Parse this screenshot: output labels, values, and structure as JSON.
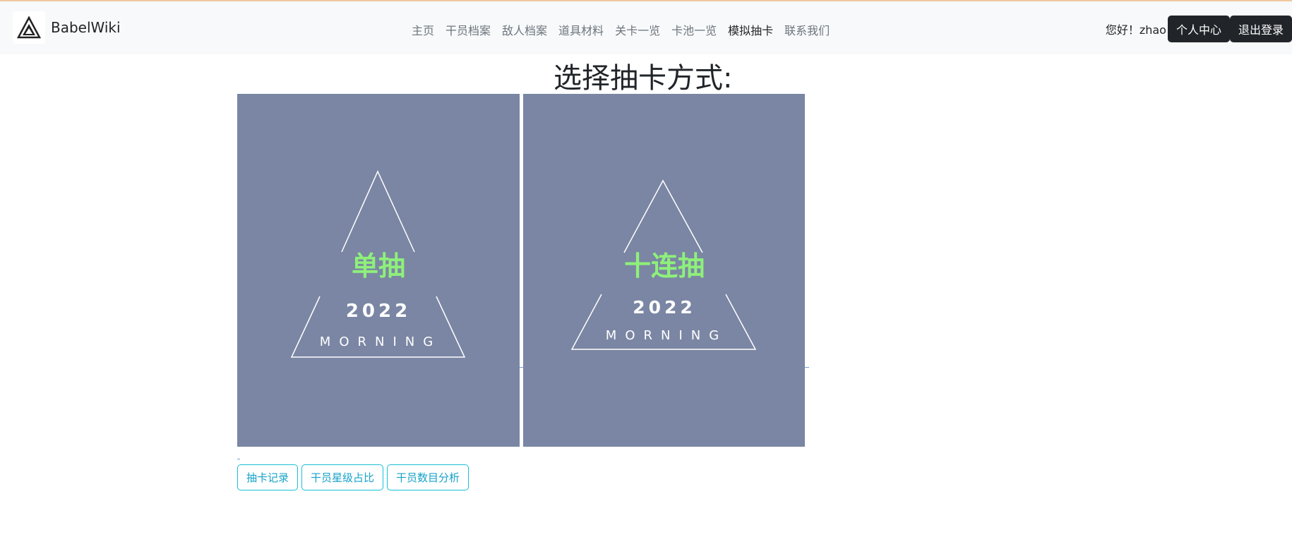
{
  "brand": {
    "name": "BabelWiki",
    "logo_icon": "triangle-logo-icon"
  },
  "nav": {
    "items": [
      {
        "label": "主页"
      },
      {
        "label": "干员档案"
      },
      {
        "label": "敌人档案"
      },
      {
        "label": "道具材料"
      },
      {
        "label": "关卡一览"
      },
      {
        "label": "卡池一览"
      },
      {
        "label": "模拟抽卡"
      },
      {
        "label": "联系我们"
      }
    ]
  },
  "user": {
    "greeting": "您好！zhao",
    "profile_label": "个人中心",
    "logout_label": "退出登录"
  },
  "main": {
    "heading": "选择抽卡方式:",
    "cards": [
      {
        "title": "单抽",
        "year": "2022",
        "subtitle": "MORNING"
      },
      {
        "title": "十连抽",
        "year": "2022",
        "subtitle": "MORNING"
      }
    ],
    "actions": [
      {
        "label": "抽卡记录"
      },
      {
        "label": "干员星级占比"
      },
      {
        "label": "干员数目分析"
      }
    ]
  },
  "colors": {
    "card_bg": "#7a86a3",
    "card_title": "#8ef07a",
    "accent_cyan": "#17c0d8",
    "dark_button": "#212529"
  }
}
